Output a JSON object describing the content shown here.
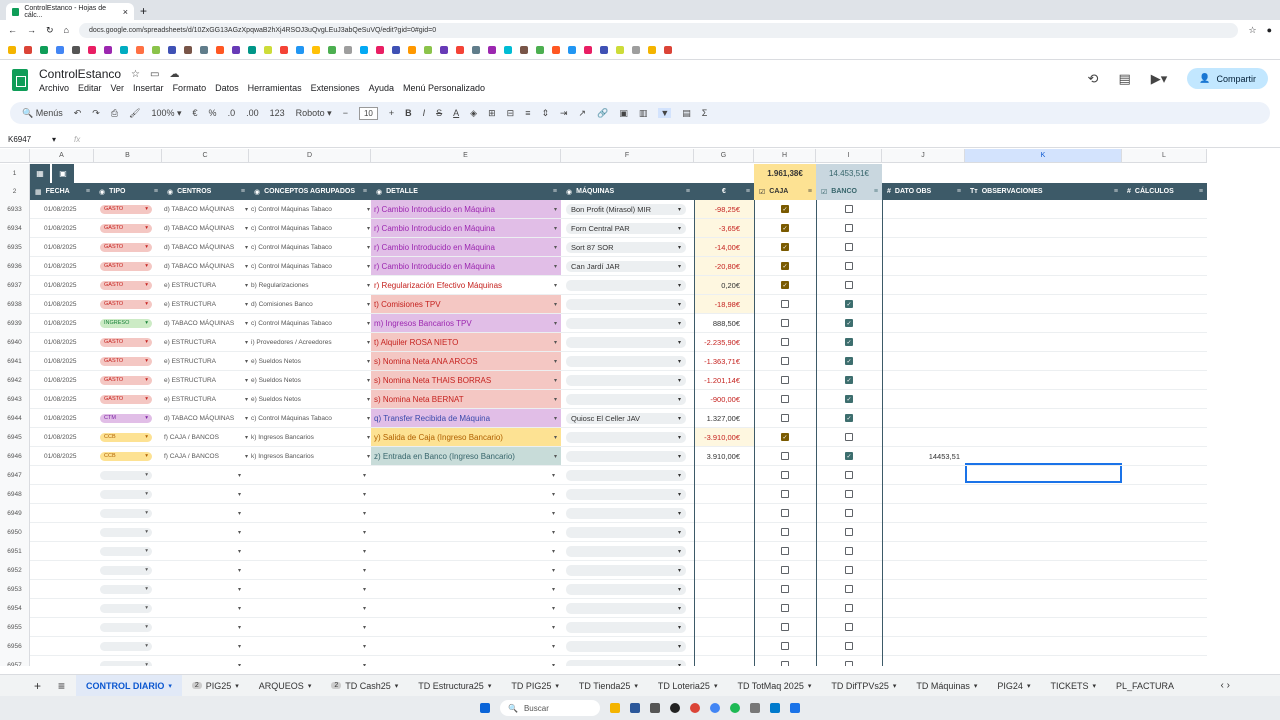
{
  "browser": {
    "tab_title": "ControlEstanco - Hojas de cálc...",
    "url": "docs.google.com/spreadsheets/d/10ZxGG13AGzXpqwaB2hXj4RSOJ3uQvgLEuJ3abQeSuVQ/edit?gid=0#gid=0"
  },
  "app": {
    "title": "ControlEstanco",
    "menus": [
      "Archivo",
      "Editar",
      "Ver",
      "Insertar",
      "Formato",
      "Datos",
      "Herramientas",
      "Extensiones",
      "Ayuda",
      "Menú Personalizado"
    ],
    "share": "Compartir"
  },
  "toolbar": {
    "menus_label": "Menús",
    "zoom": "100%",
    "euro": "€",
    "percent": "%",
    "dec_dec": ".0",
    "inc_dec": ".00",
    "format123": "123",
    "font": "Roboto",
    "font_size": "10"
  },
  "formula": {
    "cell": "K6947",
    "fx": "fx"
  },
  "columns": [
    "A",
    "B",
    "C",
    "D",
    "E",
    "F",
    "G",
    "H",
    "I",
    "J",
    "K",
    "L"
  ],
  "totals": {
    "caja": "1.961,38€",
    "banco": "14.453,51€"
  },
  "headers": {
    "fecha": "FECHA",
    "tipo": "TIPO",
    "centros": "CENTROS",
    "conceptos": "CONCEPTOS AGRUPADOS",
    "detalle": "DETALLE",
    "maquinas": "MÁQUINAS",
    "euro": "€",
    "caja": "CAJA",
    "banco": "BANCO",
    "dato_obs": "DATO OBS",
    "observaciones": "OBSERVACIONES",
    "calculos": "CÁLCULOS"
  },
  "rows": [
    {
      "n": "6933",
      "fecha": "01/08/2025",
      "tipo": "GASTO",
      "tipoColor": "#f4c7c3",
      "tipoText": "#c5221f",
      "centro": "d) TABACO MÁQUINAS",
      "concepto": "c) Control Máquinas Tabaco",
      "detalle": "r) Cambio Introducido en Máquina",
      "detColor": "#e1bee7",
      "detText": "#9c27b0",
      "maquina": "Bon Profit (Mirasol) MIR",
      "importe": "-98,25€",
      "impColor": "#c5221f",
      "caja": true,
      "banco": false
    },
    {
      "n": "6934",
      "fecha": "01/08/2025",
      "tipo": "GASTO",
      "tipoColor": "#f4c7c3",
      "tipoText": "#c5221f",
      "centro": "d) TABACO MÁQUINAS",
      "concepto": "c) Control Máquinas Tabaco",
      "detalle": "r) Cambio Introducido en Máquina",
      "detColor": "#e1bee7",
      "detText": "#9c27b0",
      "maquina": "Forn Central PAR",
      "importe": "-3,65€",
      "impColor": "#c5221f",
      "caja": true,
      "banco": false
    },
    {
      "n": "6935",
      "fecha": "01/08/2025",
      "tipo": "GASTO",
      "tipoColor": "#f4c7c3",
      "tipoText": "#c5221f",
      "centro": "d) TABACO MÁQUINAS",
      "concepto": "c) Control Máquinas Tabaco",
      "detalle": "r) Cambio Introducido en Máquina",
      "detColor": "#e1bee7",
      "detText": "#9c27b0",
      "maquina": "Sort 87 SOR",
      "importe": "-14,00€",
      "impColor": "#c5221f",
      "caja": true,
      "banco": false
    },
    {
      "n": "6936",
      "fecha": "01/08/2025",
      "tipo": "GASTO",
      "tipoColor": "#f4c7c3",
      "tipoText": "#c5221f",
      "centro": "d) TABACO MÁQUINAS",
      "concepto": "c) Control Máquinas Tabaco",
      "detalle": "r) Cambio Introducido en Máquina",
      "detColor": "#e1bee7",
      "detText": "#9c27b0",
      "maquina": "Can Jardí JAR",
      "importe": "-20,80€",
      "impColor": "#c5221f",
      "caja": true,
      "banco": false
    },
    {
      "n": "6937",
      "fecha": "01/08/2025",
      "tipo": "GASTO",
      "tipoColor": "#f4c7c3",
      "tipoText": "#c5221f",
      "centro": "e) ESTRUCTURA",
      "concepto": "b) Regularizaciones",
      "detalle": "r) Regularización Efectivo Máquinas",
      "detColor": "#ffffff",
      "detText": "#c5221f",
      "maquina": "",
      "importe": "0,20€",
      "impColor": "#333333",
      "caja": true,
      "banco": false
    },
    {
      "n": "6938",
      "fecha": "01/08/2025",
      "tipo": "GASTO",
      "tipoColor": "#f4c7c3",
      "tipoText": "#c5221f",
      "centro": "e) ESTRUCTURA",
      "concepto": "d) Comisiones Banco",
      "detalle": "t) Comisiones TPV",
      "detColor": "#f4c7c3",
      "detText": "#c5221f",
      "maquina": "",
      "importe": "-18,98€",
      "impColor": "#c5221f",
      "caja": false,
      "banco": true
    },
    {
      "n": "6939",
      "fecha": "01/08/2025",
      "tipo": "INGRESO",
      "tipoColor": "#ccebc5",
      "tipoText": "#188038",
      "centro": "d) TABACO MÁQUINAS",
      "concepto": "c) Control Máquinas Tabaco",
      "detalle": "m) Ingresos Bancarios TPV",
      "detColor": "#e1bee7",
      "detText": "#9c27b0",
      "maquina": "",
      "importe": "888,50€",
      "impColor": "#333333",
      "caja": false,
      "banco": true
    },
    {
      "n": "6940",
      "fecha": "01/08/2025",
      "tipo": "GASTO",
      "tipoColor": "#f4c7c3",
      "tipoText": "#c5221f",
      "centro": "e) ESTRUCTURA",
      "concepto": "i) Proveedores / Acreedores",
      "detalle": "t) Alquiler ROSA NIETO",
      "detColor": "#f4c7c3",
      "detText": "#c5221f",
      "maquina": "",
      "importe": "-2.235,90€",
      "impColor": "#c5221f",
      "caja": false,
      "banco": true
    },
    {
      "n": "6941",
      "fecha": "01/08/2025",
      "tipo": "GASTO",
      "tipoColor": "#f4c7c3",
      "tipoText": "#c5221f",
      "centro": "e) ESTRUCTURA",
      "concepto": "e) Sueldos Netos",
      "detalle": "s) Nomina Neta ANA ARCOS",
      "detColor": "#f4c7c3",
      "detText": "#c5221f",
      "maquina": "",
      "importe": "-1.363,71€",
      "impColor": "#c5221f",
      "caja": false,
      "banco": true
    },
    {
      "n": "6942",
      "fecha": "01/08/2025",
      "tipo": "GASTO",
      "tipoColor": "#f4c7c3",
      "tipoText": "#c5221f",
      "centro": "e) ESTRUCTURA",
      "concepto": "e) Sueldos Netos",
      "detalle": "s) Nomina Neta THAIS BORRAS",
      "detColor": "#f4c7c3",
      "detText": "#c5221f",
      "maquina": "",
      "importe": "-1.201,14€",
      "impColor": "#c5221f",
      "caja": false,
      "banco": true
    },
    {
      "n": "6943",
      "fecha": "01/08/2025",
      "tipo": "GASTO",
      "tipoColor": "#f4c7c3",
      "tipoText": "#c5221f",
      "centro": "e) ESTRUCTURA",
      "concepto": "e) Sueldos Netos",
      "detalle": "s) Nomina Neta BERNAT",
      "detColor": "#f4c7c3",
      "detText": "#c5221f",
      "maquina": "",
      "importe": "-900,00€",
      "impColor": "#c5221f",
      "caja": false,
      "banco": true
    },
    {
      "n": "6944",
      "fecha": "01/08/2025",
      "tipo": "CTM",
      "tipoColor": "#e1bee7",
      "tipoText": "#7b1fa2",
      "centro": "d) TABACO MÁQUINAS",
      "concepto": "c) Control Máquinas Tabaco",
      "detalle": "q) Transfer Recibida de Máquina",
      "detColor": "#e1bee7",
      "detText": "#3949ab",
      "maquina": "Quiosc El Celler JAV",
      "importe": "1.327,00€",
      "impColor": "#333333",
      "caja": false,
      "banco": true
    },
    {
      "n": "6945",
      "fecha": "01/08/2025",
      "tipo": "CCB",
      "tipoColor": "#fde293",
      "tipoText": "#b06000",
      "centro": "f) CAJA / BANCOS",
      "concepto": "k) Ingresos Bancarios",
      "detalle": "y) Salida de Caja (Ingreso Bancario)",
      "detColor": "#fde293",
      "detText": "#b06000",
      "maquina": "",
      "importe": "-3.910,00€",
      "impColor": "#c5221f",
      "caja": true,
      "banco": false
    },
    {
      "n": "6946",
      "fecha": "01/08/2025",
      "tipo": "CCB",
      "tipoColor": "#fde293",
      "tipoText": "#b06000",
      "centro": "f) CAJA / BANCOS",
      "concepto": "k) Ingresos Bancarios",
      "detalle": "z) Entrada en Banco (Ingreso Bancario)",
      "detColor": "#c8dcd9",
      "detText": "#37656b",
      "maquina": "",
      "importe": "3.910,00€",
      "impColor": "#333333",
      "caja": false,
      "banco": true,
      "dato": "14453,51"
    }
  ],
  "empty_rows": [
    "6947",
    "6948",
    "6949",
    "6950",
    "6951",
    "6952",
    "6953",
    "6954",
    "6955",
    "6956",
    "6957"
  ],
  "sheet_tabs": [
    {
      "label": "CONTROL DIARIO",
      "active": true
    },
    {
      "label": "PIG25",
      "badge": "2"
    },
    {
      "label": "ARQUEOS"
    },
    {
      "label": "TD Cash25",
      "badge": "2"
    },
    {
      "label": "TD Estructura25"
    },
    {
      "label": "TD PIG25"
    },
    {
      "label": "TD Tienda25"
    },
    {
      "label": "TD Loteria25"
    },
    {
      "label": "TD TotMaq 2025"
    },
    {
      "label": "TD DifTPVs25"
    },
    {
      "label": "TD Máquinas"
    },
    {
      "label": "PIG24"
    },
    {
      "label": "TICKETS"
    },
    {
      "label": "PL_FACTURA"
    }
  ],
  "taskbar": {
    "search": "Buscar"
  }
}
